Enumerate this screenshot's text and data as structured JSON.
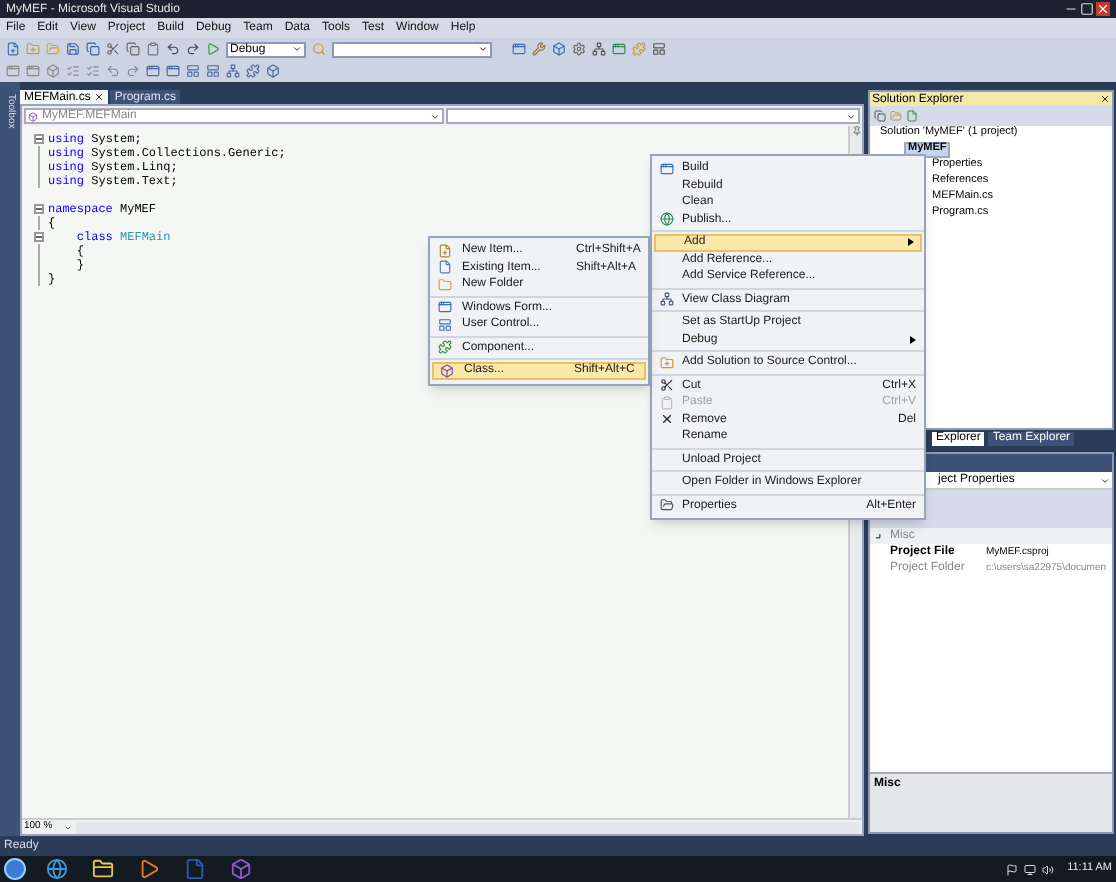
{
  "window": {
    "title": "MyMEF - Microsoft Visual Studio"
  },
  "menu_bar": [
    "File",
    "Edit",
    "View",
    "Project",
    "Build",
    "Debug",
    "Team",
    "Data",
    "Tools",
    "Test",
    "Window",
    "Help"
  ],
  "toolbar": {
    "configuration": "Debug"
  },
  "side_tab": "Toolbox",
  "editor_tabs": [
    {
      "label": "MEFMain.cs",
      "selected": true
    },
    {
      "label": "Program.cs",
      "selected": false
    }
  ],
  "navigation_bar": {
    "type_combo": "MyMEF.MEFMain"
  },
  "code_blocks": [
    [
      {
        "collapsible": true,
        "tokens": [
          {
            "kind": "keyword",
            "text": "using"
          },
          {
            "kind": "plain",
            "text": " System;"
          }
        ]
      },
      {
        "collapsible": false,
        "tokens": [
          {
            "kind": "keyword",
            "text": "using"
          },
          {
            "kind": "plain",
            "text": " System.Collections.Generic;"
          }
        ]
      },
      {
        "collapsible": false,
        "tokens": [
          {
            "kind": "keyword",
            "text": "using"
          },
          {
            "kind": "plain",
            "text": " System.Linq;"
          }
        ]
      },
      {
        "collapsible": false,
        "tokens": [
          {
            "kind": "keyword",
            "text": "using"
          },
          {
            "kind": "plain",
            "text": " System.Text;"
          }
        ]
      }
    ],
    [
      {
        "collapsible": true,
        "tokens": [
          {
            "kind": "keyword",
            "text": "namespace"
          },
          {
            "kind": "plain",
            "text": " MyMEF"
          }
        ]
      },
      {
        "collapsible": false,
        "tokens": [
          {
            "kind": "plain",
            "text": "{"
          }
        ]
      },
      {
        "collapsible": true,
        "tokens": [
          {
            "kind": "keyword",
            "text": "    class "
          },
          {
            "kind": "type",
            "text": "MEFMain"
          }
        ]
      },
      {
        "collapsible": false,
        "tokens": [
          {
            "kind": "plain",
            "text": "    {"
          }
        ]
      },
      {
        "collapsible": false,
        "tokens": [
          {
            "kind": "plain",
            "text": "    }"
          }
        ]
      },
      {
        "collapsible": false,
        "tokens": [
          {
            "kind": "plain",
            "text": "}"
          }
        ]
      }
    ]
  ],
  "zoom": "100 %",
  "solution_explorer": {
    "title": "Solution Explorer",
    "tree": [
      {
        "label": "Solution 'MyMEF' (1 project)",
        "selected": false,
        "children": [
          {
            "label": "MyMEF",
            "selected": true,
            "children": [
              {
                "label": "Properties",
                "selected": false
              },
              {
                "label": "References",
                "selected": false
              },
              {
                "label": "MEFMain.cs",
                "selected": false
              },
              {
                "label": "Program.cs",
                "selected": false
              }
            ]
          }
        ]
      }
    ]
  },
  "panel_tabs": [
    {
      "label": "Explorer",
      "selected": true
    },
    {
      "label": "Team Explorer",
      "selected": false
    }
  ],
  "properties": {
    "object": "ject Properties",
    "category": "Misc",
    "rows": [
      {
        "name": "Project File",
        "value": "MyMEF.csproj",
        "disabled": false
      },
      {
        "name": "Project Folder",
        "value": "c:\\users\\sa22975\\documen",
        "disabled": true
      }
    ],
    "description": "Misc"
  },
  "context_menu": {
    "groups": [
      {
        "items": [
          {
            "label": "Build",
            "has_submenu": false,
            "selected": false,
            "disabled": false
          },
          {
            "label": "Rebuild",
            "has_submenu": false,
            "selected": false,
            "disabled": false
          },
          {
            "label": "Clean",
            "has_submenu": false,
            "selected": false,
            "disabled": false
          },
          {
            "label": "Publish...",
            "has_submenu": false,
            "selected": false,
            "disabled": false
          }
        ]
      },
      {
        "items": [
          {
            "label": "Add",
            "has_submenu": true,
            "selected": true,
            "disabled": false
          },
          {
            "label": "Add Reference...",
            "has_submenu": false,
            "selected": false,
            "disabled": false
          },
          {
            "label": "Add Service Reference...",
            "has_submenu": false,
            "selected": false,
            "disabled": false
          }
        ]
      },
      {
        "items": [
          {
            "label": "View Class Diagram",
            "has_submenu": false,
            "selected": false,
            "disabled": false
          }
        ]
      },
      {
        "items": [
          {
            "label": "Set as StartUp Project",
            "has_submenu": false,
            "selected": false,
            "disabled": false
          },
          {
            "label": "Debug",
            "has_submenu": true,
            "selected": false,
            "disabled": false
          }
        ]
      },
      {
        "items": [
          {
            "label": "Add Solution to Source Control...",
            "has_submenu": false,
            "selected": false,
            "disabled": false
          }
        ]
      },
      {
        "items": [
          {
            "label": "Cut",
            "shortcut": "Ctrl+X",
            "has_submenu": false,
            "selected": false,
            "disabled": false
          },
          {
            "label": "Paste",
            "shortcut": "Ctrl+V",
            "has_submenu": false,
            "selected": false,
            "disabled": true
          },
          {
            "label": "Remove",
            "shortcut": "Del",
            "has_submenu": false,
            "selected": false,
            "disabled": false
          },
          {
            "label": "Rename",
            "has_submenu": false,
            "selected": false,
            "disabled": false
          }
        ]
      },
      {
        "items": [
          {
            "label": "Unload Project",
            "has_submenu": false,
            "selected": false,
            "disabled": false
          }
        ]
      },
      {
        "items": [
          {
            "label": "Open Folder in Windows Explorer",
            "has_submenu": false,
            "selected": false,
            "disabled": false
          }
        ]
      },
      {
        "items": [
          {
            "label": "Properties",
            "shortcut": "Alt+Enter",
            "has_submenu": false,
            "selected": false,
            "disabled": false
          }
        ]
      }
    ]
  },
  "submenu": {
    "groups": [
      {
        "items": [
          {
            "label": "New Item...",
            "shortcut": "Ctrl+Shift+A",
            "selected": false
          },
          {
            "label": "Existing Item...",
            "shortcut": "Shift+Alt+A",
            "selected": false
          },
          {
            "label": "New Folder",
            "selected": false
          }
        ]
      },
      {
        "items": [
          {
            "label": "Windows Form...",
            "selected": false
          },
          {
            "label": "User Control...",
            "selected": false
          }
        ]
      },
      {
        "items": [
          {
            "label": "Component...",
            "selected": false
          }
        ]
      },
      {
        "items": [
          {
            "label": "Class...",
            "shortcut": "Shift+Alt+C",
            "selected": true
          }
        ]
      }
    ]
  },
  "status_bar": "Ready",
  "taskbar": {
    "clock": "11:11 AM"
  }
}
